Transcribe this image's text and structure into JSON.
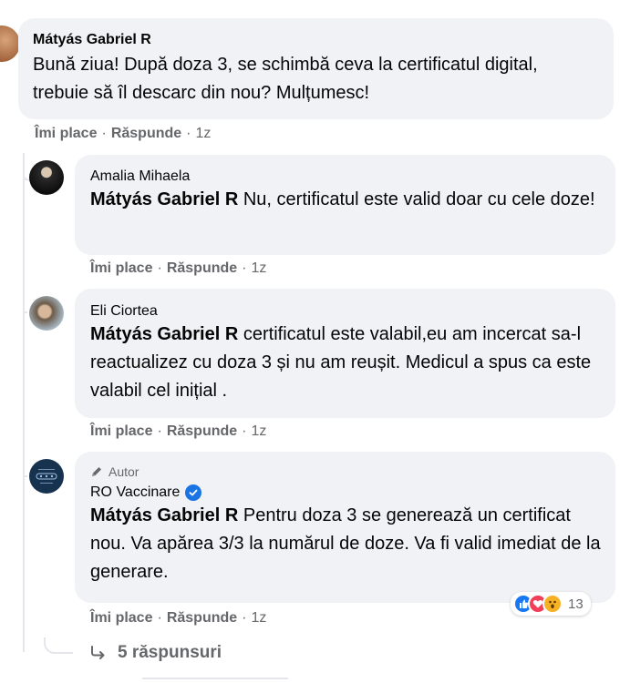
{
  "comments": [
    {
      "author": "Mátyás Gabriel R",
      "text": "Bună ziua! După doza 3, se schimbă ceva la certificatul digital, trebuie să îl descarc din nou? Mulțumesc!",
      "actions": {
        "like": "Îmi place",
        "reply": "Răspunde",
        "time": "1z"
      }
    }
  ],
  "replies": [
    {
      "author": "Amalia Mihaela",
      "mention": "Mátyás Gabriel R",
      "text": " Nu, certificatul este valid doar cu cele doze!",
      "actions": {
        "like": "Îmi place",
        "reply": "Răspunde",
        "time": "1z"
      }
    },
    {
      "author": "Eli Ciortea",
      "mention": "Mátyás Gabriel R",
      "text": " certificatul este valabil,eu am incercat sa-l reactualizez cu doza 3 și nu am reușit. Medicul a spus ca este valabil cel inițial .",
      "actions": {
        "like": "Îmi place",
        "reply": "Răspunde",
        "time": "1z"
      }
    },
    {
      "badge": "Autor",
      "author": "RO Vaccinare",
      "verified": true,
      "mention": "Mátyás Gabriel R",
      "text": " Pentru doza 3 se generează un certificat nou. Va apărea 3/3 la numărul de doze. Va fi valid imediat de la generare.",
      "actions": {
        "like": "Îmi place",
        "reply": "Răspunde",
        "time": "1z"
      },
      "reactions": {
        "icons": [
          "like-icon",
          "love-icon",
          "wow-icon"
        ],
        "count": "13"
      }
    }
  ],
  "more_replies": {
    "label": "5 răspunsuri",
    "icon": "reply-arrow-icon"
  },
  "colors": {
    "bubble": "#f0f2f5",
    "meta": "#65676b",
    "verified": "#1b74e4",
    "like": "#1877f2",
    "love": "#f33e58",
    "wow": "#f7b125"
  }
}
